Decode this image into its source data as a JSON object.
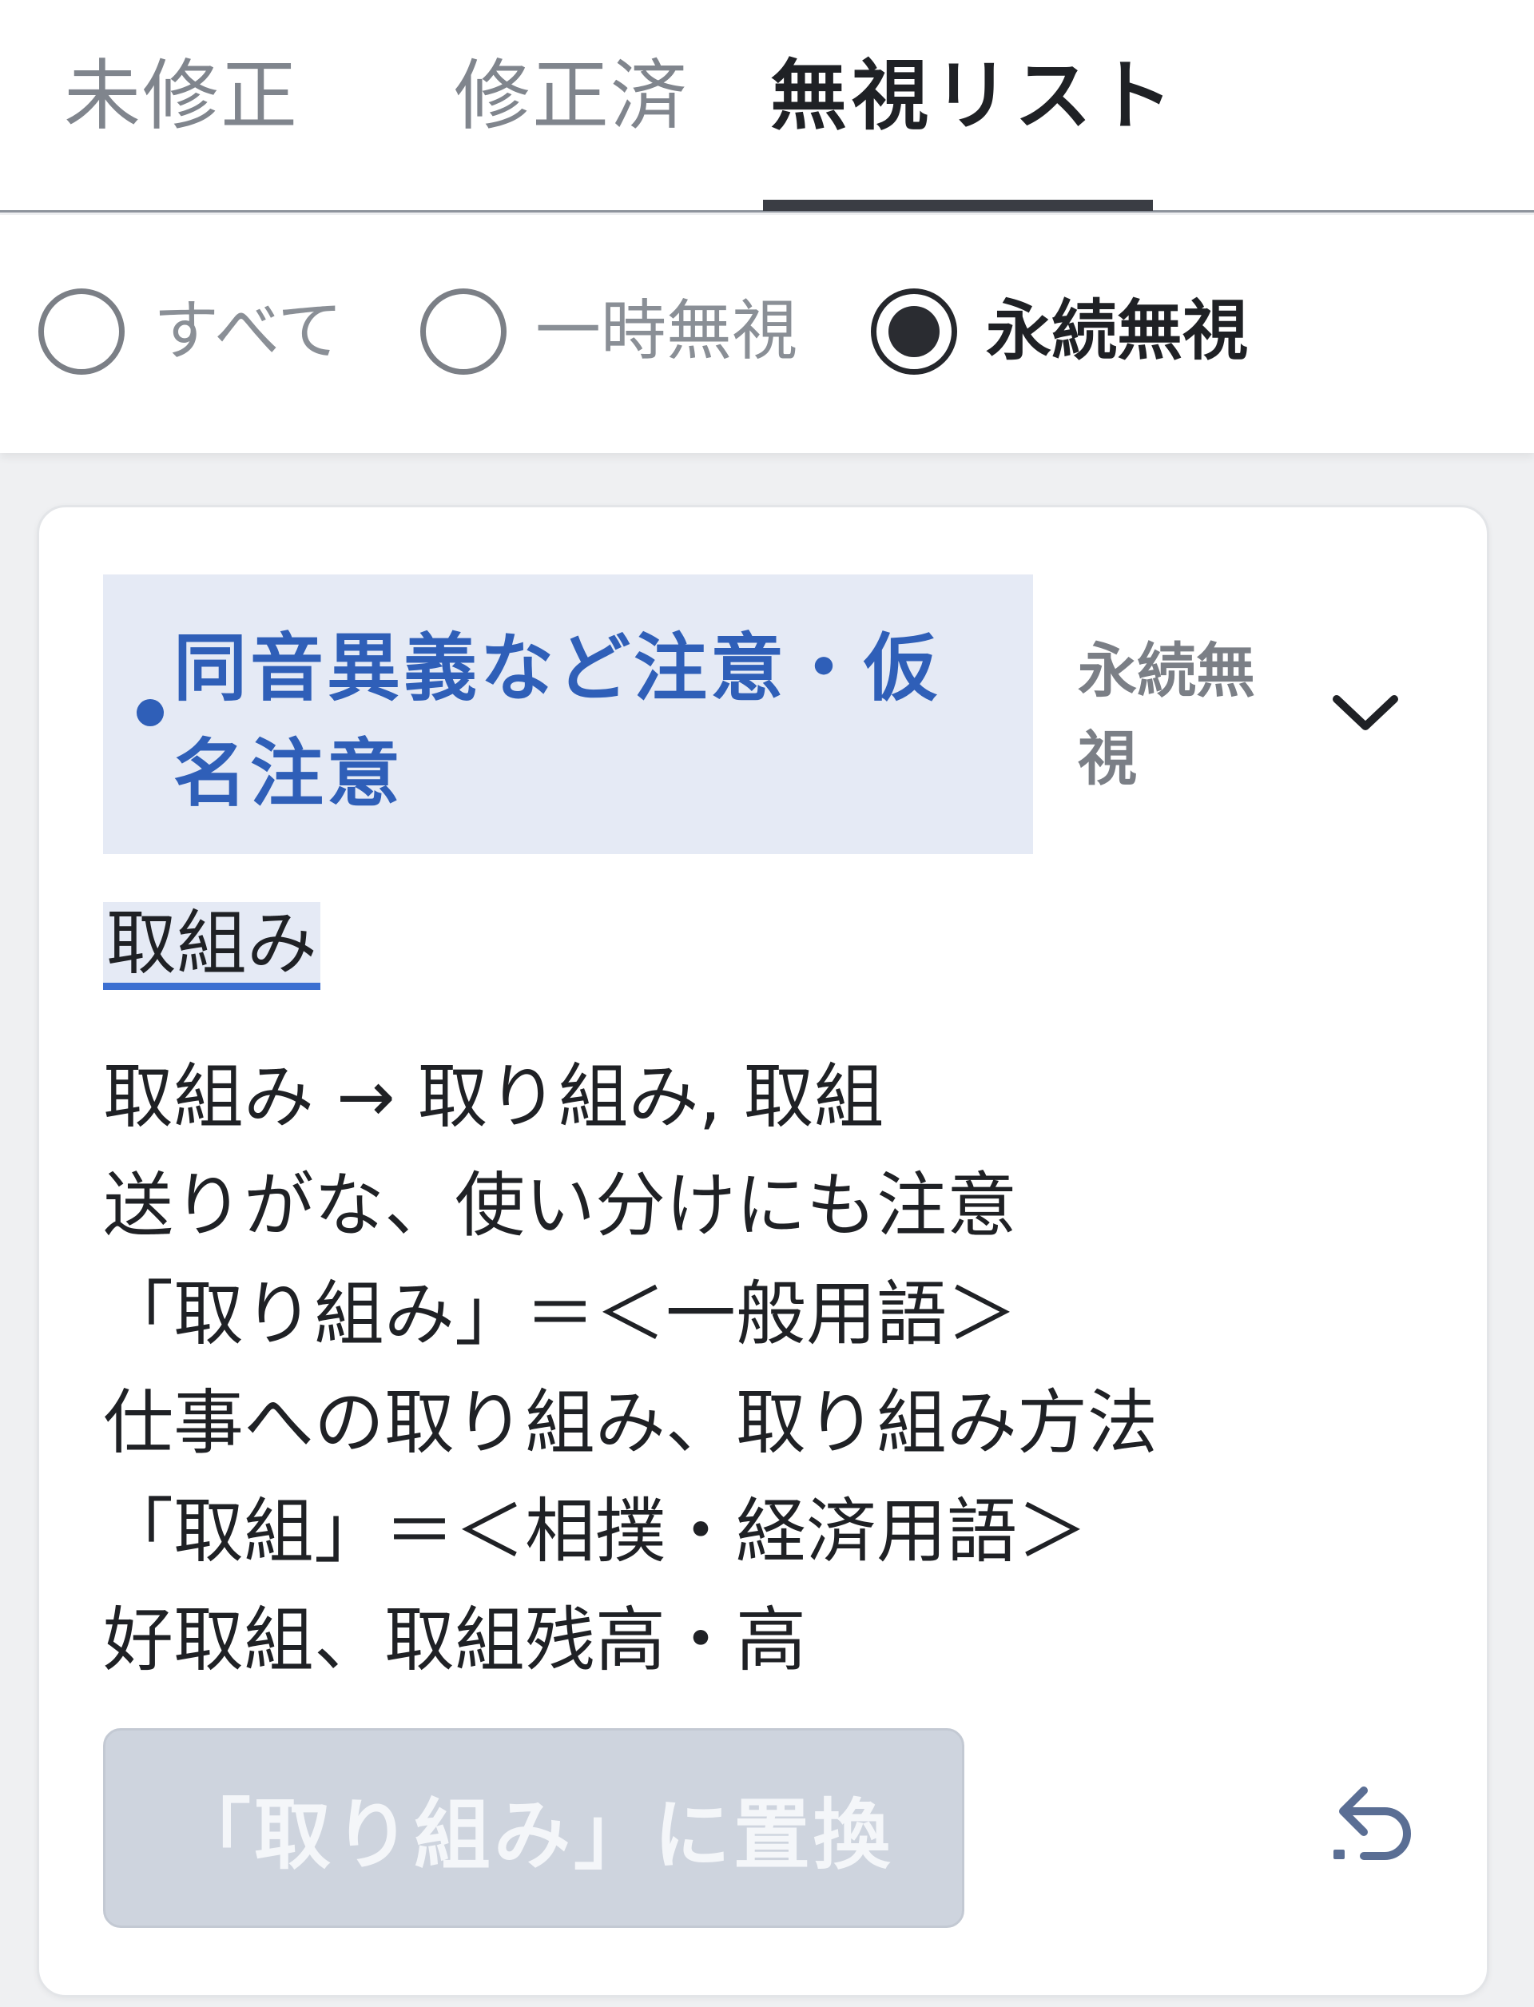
{
  "tabs": [
    {
      "label": "未修正",
      "active": false
    },
    {
      "label": "修正済",
      "active": false
    },
    {
      "label": "無視リスト",
      "active": true
    }
  ],
  "filters": {
    "options": [
      {
        "label": "すべて",
        "selected": false
      },
      {
        "label": "一時無視",
        "selected": false
      },
      {
        "label": "永続無視",
        "selected": true
      }
    ]
  },
  "card": {
    "category": "同音異義など注意・仮名注意",
    "status": "永続無視",
    "target_word": "取組み",
    "description_lines": [
      "取組み → 取り組み, 取組",
      "送りがな、使い分けにも注意",
      "「取り組み」＝＜一般用語＞",
      "仕事への取り組み、取り組み方法",
      "「取組」＝＜相撲・経済用語＞",
      "好取組、取組残高・高"
    ],
    "replace_button": "「取り組み」に置換",
    "icons": {
      "status_toggle": "chevron-down-icon",
      "undo": "undo-icon"
    }
  },
  "colors": {
    "accent_blue": "#2f5fb8",
    "category_bg": "#e5eaf5",
    "disabled_button_bg": "#ced4de",
    "active_tab_indicator": "#3a3d44"
  }
}
